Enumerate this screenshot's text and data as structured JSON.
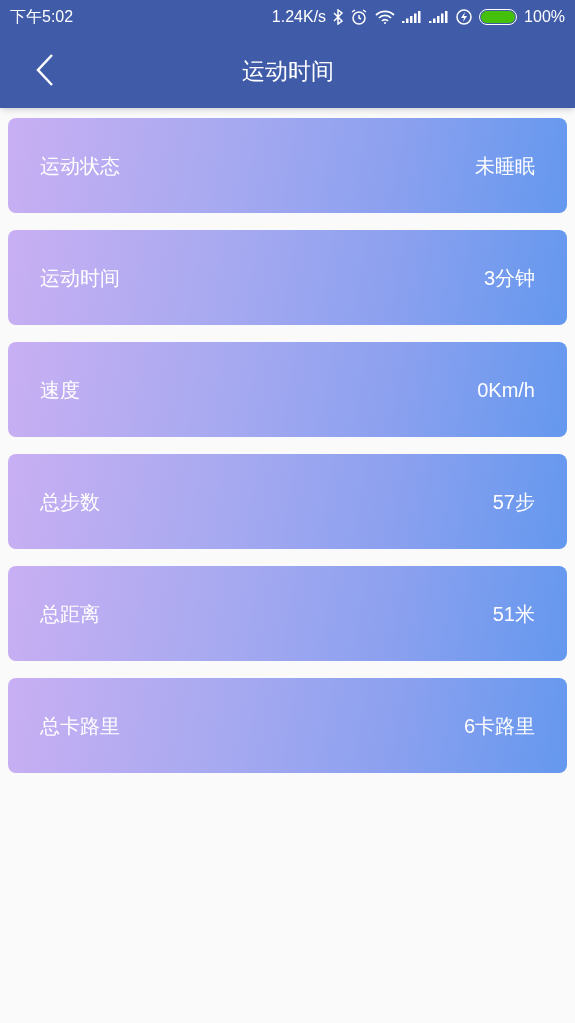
{
  "status_bar": {
    "time": "下午5:02",
    "speed": "1.24K/s",
    "battery": "100%"
  },
  "app_bar": {
    "title": "运动时间"
  },
  "items": [
    {
      "label": "运动状态",
      "value": "未睡眠"
    },
    {
      "label": "运动时间",
      "value": "3分钟"
    },
    {
      "label": "速度",
      "value": "0Km/h"
    },
    {
      "label": "总步数",
      "value": "57步"
    },
    {
      "label": "总距离",
      "value": "51米"
    },
    {
      "label": "总卡路里",
      "value": "6卡路里"
    }
  ]
}
